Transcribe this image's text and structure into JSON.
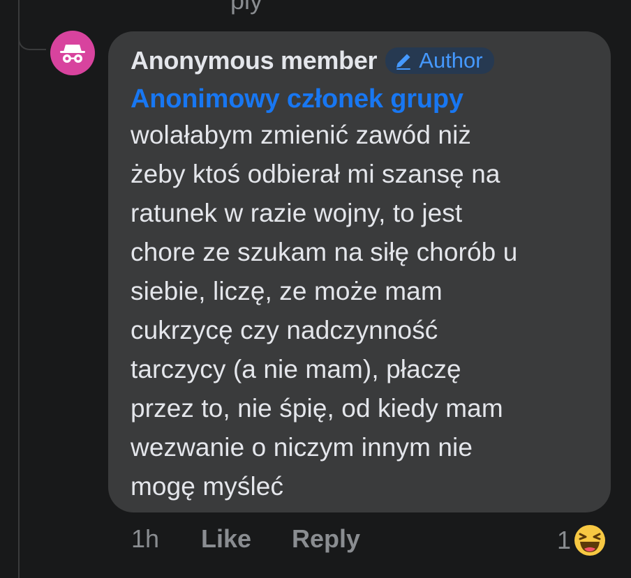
{
  "previous": {
    "reply_partial": "ply"
  },
  "comment": {
    "author": "Anonymous member",
    "badge": "Author",
    "mention": "Anonimowy członek grupy",
    "text_lines": [
      "wolałabym zmienić zawód niż",
      "żeby ktoś odbierał mi szansę na",
      "ratunek w razie wojny, to jest",
      "chore ze szukam na siłę chorób u",
      "siebie, liczę, ze może mam",
      "cukrzycę czy nadczynność",
      "tarczycy (a nie mam), płaczę",
      "przez to, nie śpię, od kiedy mam",
      "wezwanie o niczym innym nie",
      "mogę myśleć"
    ],
    "avatar_icon": "incognito-icon",
    "avatar_color": "#d8439e"
  },
  "actions": {
    "time": "1h",
    "like": "Like",
    "reply": "Reply"
  },
  "reactions": {
    "count": "1",
    "icon": "haha-emoji-icon"
  }
}
